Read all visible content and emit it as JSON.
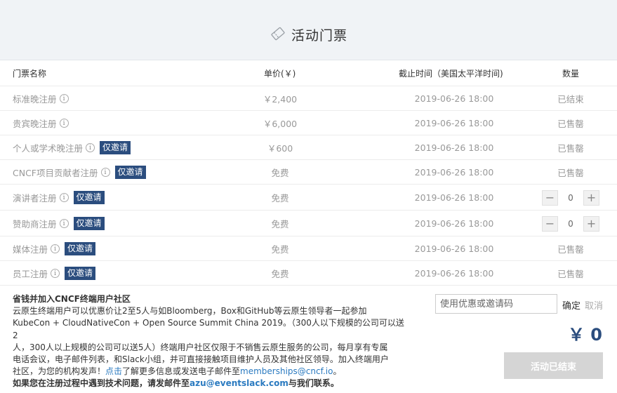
{
  "header": {
    "title": "活动门票",
    "icon": "ticket-icon"
  },
  "columns": {
    "name": "门票名称",
    "price": "单价(￥)",
    "deadline": "截止时间（美国太平洋时间)",
    "quantity": "数量"
  },
  "tickets": [
    {
      "name": "标准晚注册",
      "badge": "",
      "price": "￥2,400",
      "deadline": "2019-06-26 18:00",
      "status": "已结束"
    },
    {
      "name": "贵宾晚注册",
      "badge": "",
      "price": "￥6,000",
      "deadline": "2019-06-26 18:00",
      "status": "已售罄"
    },
    {
      "name": "个人或学术晚注册",
      "badge": "仅邀请",
      "price": "￥600",
      "deadline": "2019-06-26 18:00",
      "status": "已售罄"
    },
    {
      "name": "CNCF项目贡献者注册",
      "badge": "仅邀请",
      "price": "免费",
      "deadline": "2019-06-26 18:00",
      "status": "已售罄"
    },
    {
      "name": "演讲者注册",
      "badge": "仅邀请",
      "price": "免费",
      "deadline": "2019-06-26 18:00",
      "status": "",
      "quantity": "0"
    },
    {
      "name": "赞助商注册",
      "badge": "仅邀请",
      "price": "免费",
      "deadline": "2019-06-26 18:00",
      "status": "",
      "quantity": "0"
    },
    {
      "name": "媒体注册",
      "badge": "仅邀请",
      "price": "免费",
      "deadline": "2019-06-26 18:00",
      "status": "已售罄"
    },
    {
      "name": "员工注册",
      "badge": "仅邀请",
      "price": "免费",
      "deadline": "2019-06-26 18:00",
      "status": "已售罄"
    }
  ],
  "community": {
    "title": "省钱并加入CNCF终端用户社区",
    "body_1": "云原生终端用户可以优惠价让2至5人与如Bloomberg，Box和GitHub等云原生领导者一起参加",
    "body_2": "KubeCon + CloudNativeCon + Open Source Summit China 2019。（300人以下规模的公司可以送2",
    "body_3": "人，300人以上规模的公司可以送5人）终端用户社区仅限于不销售云原生服务的公司，每月享有专属",
    "body_4": "电话会议，电子邮件列表，和Slack小组，并可直接接触项目维护人员及其他社区领导。加入终端用户",
    "body_5a": "社区，为您的机构发声！",
    "link_click": "点击",
    "body_5b": "了解更多信息或发送电子邮件至",
    "email_1": "memberships@cncf.io",
    "body_5c": "。",
    "contact_a": "如果您在注册过程中遇到技术问题，请发邮件至",
    "email_2": "azu@eventslack.com",
    "contact_b": "与我们联系。"
  },
  "coupon": {
    "placeholder": "使用优惠或邀请码",
    "confirm": "确定",
    "cancel": "取消"
  },
  "total": "￥ 0",
  "submit": "活动已结束",
  "colors": {
    "accent": "#2b4d7e",
    "link": "#2a7ac0",
    "header_bg": "#f0f3f6",
    "disabled": "#d5d5d5"
  }
}
